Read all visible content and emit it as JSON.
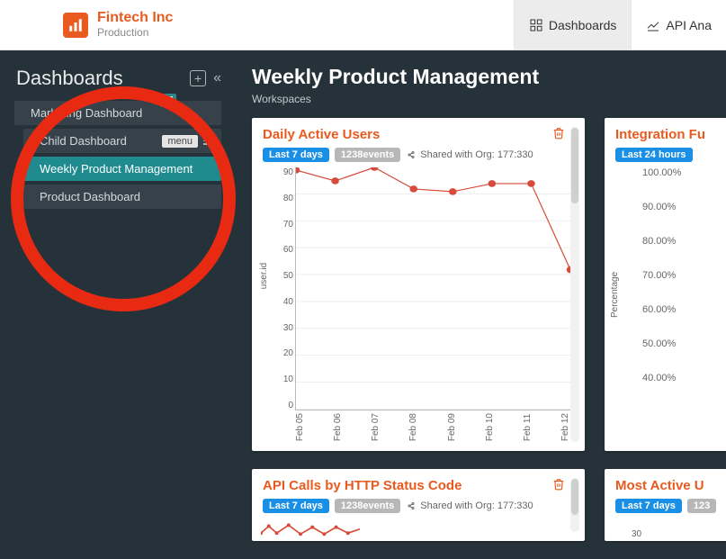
{
  "brand": {
    "name": "Fintech Inc",
    "env": "Production"
  },
  "topnav": {
    "dashboards": "Dashboards",
    "api": "API Ana"
  },
  "sidebar": {
    "title": "Dashboards",
    "items": [
      {
        "label": "Marketing Dashboard"
      },
      {
        "label": "Child Dashboard",
        "menu": "menu"
      },
      {
        "label": "Weekly Product Management"
      },
      {
        "label": "Product Dashboard"
      }
    ]
  },
  "content": {
    "title": "Weekly Product Management",
    "subtitle": "Workspaces"
  },
  "cards": {
    "dau": {
      "title": "Daily Active Users",
      "range": "Last 7 days",
      "events": "1238events",
      "shared": "Shared with Org: 177:330"
    },
    "funnel": {
      "title": "Integration Fu",
      "range": "Last 24 hours"
    },
    "api": {
      "title": "API Calls by HTTP Status Code",
      "range": "Last 7 days",
      "events": "1238events",
      "shared": "Shared with Org: 177:330"
    },
    "active": {
      "title": "Most Active U",
      "range": "Last 7 days",
      "events": "123",
      "tick": "30"
    }
  },
  "chart_data": {
    "type": "line",
    "title": "Daily Active Users",
    "xlabel": "",
    "ylabel": "user.id",
    "ylim": [
      0,
      90
    ],
    "yticks": [
      90,
      80,
      70,
      60,
      50,
      40,
      30,
      20,
      10,
      0
    ],
    "categories": [
      "Feb 05",
      "Feb 06",
      "Feb 07",
      "Feb 08",
      "Feb 09",
      "Feb 10",
      "Feb 11",
      "Feb 12"
    ],
    "values": [
      89,
      85,
      90,
      82,
      81,
      84,
      84,
      52
    ]
  },
  "funnel_ticks": [
    "100.00%",
    "90.00%",
    "80.00%",
    "70.00%",
    "60.00%",
    "50.00%",
    "40.00%"
  ],
  "funnel_ylabel": "Percentage"
}
